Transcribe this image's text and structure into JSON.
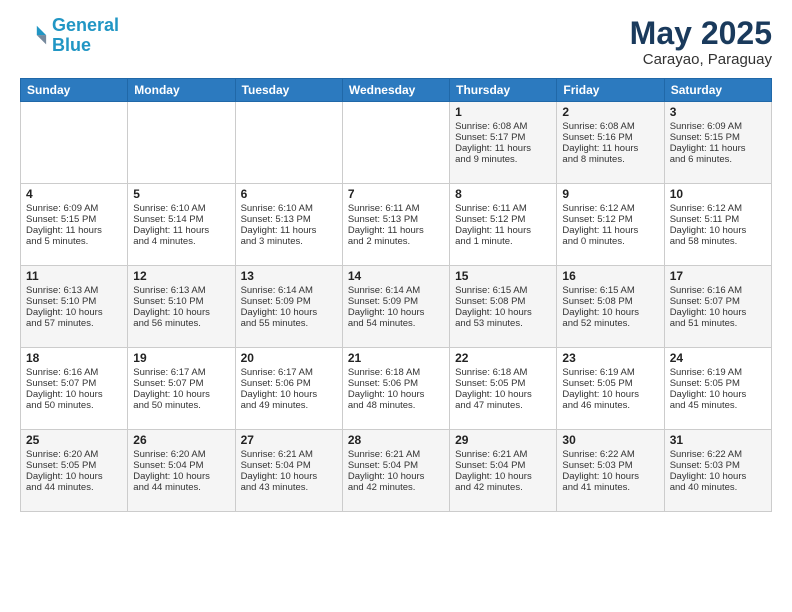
{
  "header": {
    "logo_line1": "General",
    "logo_line2": "Blue",
    "main_title": "May 2025",
    "subtitle": "Carayao, Paraguay"
  },
  "weekdays": [
    "Sunday",
    "Monday",
    "Tuesday",
    "Wednesday",
    "Thursday",
    "Friday",
    "Saturday"
  ],
  "weeks": [
    [
      {
        "num": "",
        "text": ""
      },
      {
        "num": "",
        "text": ""
      },
      {
        "num": "",
        "text": ""
      },
      {
        "num": "",
        "text": ""
      },
      {
        "num": "1",
        "text": "Sunrise: 6:08 AM\nSunset: 5:17 PM\nDaylight: 11 hours\nand 9 minutes."
      },
      {
        "num": "2",
        "text": "Sunrise: 6:08 AM\nSunset: 5:16 PM\nDaylight: 11 hours\nand 8 minutes."
      },
      {
        "num": "3",
        "text": "Sunrise: 6:09 AM\nSunset: 5:15 PM\nDaylight: 11 hours\nand 6 minutes."
      }
    ],
    [
      {
        "num": "4",
        "text": "Sunrise: 6:09 AM\nSunset: 5:15 PM\nDaylight: 11 hours\nand 5 minutes."
      },
      {
        "num": "5",
        "text": "Sunrise: 6:10 AM\nSunset: 5:14 PM\nDaylight: 11 hours\nand 4 minutes."
      },
      {
        "num": "6",
        "text": "Sunrise: 6:10 AM\nSunset: 5:13 PM\nDaylight: 11 hours\nand 3 minutes."
      },
      {
        "num": "7",
        "text": "Sunrise: 6:11 AM\nSunset: 5:13 PM\nDaylight: 11 hours\nand 2 minutes."
      },
      {
        "num": "8",
        "text": "Sunrise: 6:11 AM\nSunset: 5:12 PM\nDaylight: 11 hours\nand 1 minute."
      },
      {
        "num": "9",
        "text": "Sunrise: 6:12 AM\nSunset: 5:12 PM\nDaylight: 11 hours\nand 0 minutes."
      },
      {
        "num": "10",
        "text": "Sunrise: 6:12 AM\nSunset: 5:11 PM\nDaylight: 10 hours\nand 58 minutes."
      }
    ],
    [
      {
        "num": "11",
        "text": "Sunrise: 6:13 AM\nSunset: 5:10 PM\nDaylight: 10 hours\nand 57 minutes."
      },
      {
        "num": "12",
        "text": "Sunrise: 6:13 AM\nSunset: 5:10 PM\nDaylight: 10 hours\nand 56 minutes."
      },
      {
        "num": "13",
        "text": "Sunrise: 6:14 AM\nSunset: 5:09 PM\nDaylight: 10 hours\nand 55 minutes."
      },
      {
        "num": "14",
        "text": "Sunrise: 6:14 AM\nSunset: 5:09 PM\nDaylight: 10 hours\nand 54 minutes."
      },
      {
        "num": "15",
        "text": "Sunrise: 6:15 AM\nSunset: 5:08 PM\nDaylight: 10 hours\nand 53 minutes."
      },
      {
        "num": "16",
        "text": "Sunrise: 6:15 AM\nSunset: 5:08 PM\nDaylight: 10 hours\nand 52 minutes."
      },
      {
        "num": "17",
        "text": "Sunrise: 6:16 AM\nSunset: 5:07 PM\nDaylight: 10 hours\nand 51 minutes."
      }
    ],
    [
      {
        "num": "18",
        "text": "Sunrise: 6:16 AM\nSunset: 5:07 PM\nDaylight: 10 hours\nand 50 minutes."
      },
      {
        "num": "19",
        "text": "Sunrise: 6:17 AM\nSunset: 5:07 PM\nDaylight: 10 hours\nand 50 minutes."
      },
      {
        "num": "20",
        "text": "Sunrise: 6:17 AM\nSunset: 5:06 PM\nDaylight: 10 hours\nand 49 minutes."
      },
      {
        "num": "21",
        "text": "Sunrise: 6:18 AM\nSunset: 5:06 PM\nDaylight: 10 hours\nand 48 minutes."
      },
      {
        "num": "22",
        "text": "Sunrise: 6:18 AM\nSunset: 5:05 PM\nDaylight: 10 hours\nand 47 minutes."
      },
      {
        "num": "23",
        "text": "Sunrise: 6:19 AM\nSunset: 5:05 PM\nDaylight: 10 hours\nand 46 minutes."
      },
      {
        "num": "24",
        "text": "Sunrise: 6:19 AM\nSunset: 5:05 PM\nDaylight: 10 hours\nand 45 minutes."
      }
    ],
    [
      {
        "num": "25",
        "text": "Sunrise: 6:20 AM\nSunset: 5:05 PM\nDaylight: 10 hours\nand 44 minutes."
      },
      {
        "num": "26",
        "text": "Sunrise: 6:20 AM\nSunset: 5:04 PM\nDaylight: 10 hours\nand 44 minutes."
      },
      {
        "num": "27",
        "text": "Sunrise: 6:21 AM\nSunset: 5:04 PM\nDaylight: 10 hours\nand 43 minutes."
      },
      {
        "num": "28",
        "text": "Sunrise: 6:21 AM\nSunset: 5:04 PM\nDaylight: 10 hours\nand 42 minutes."
      },
      {
        "num": "29",
        "text": "Sunrise: 6:21 AM\nSunset: 5:04 PM\nDaylight: 10 hours\nand 42 minutes."
      },
      {
        "num": "30",
        "text": "Sunrise: 6:22 AM\nSunset: 5:03 PM\nDaylight: 10 hours\nand 41 minutes."
      },
      {
        "num": "31",
        "text": "Sunrise: 6:22 AM\nSunset: 5:03 PM\nDaylight: 10 hours\nand 40 minutes."
      }
    ]
  ]
}
